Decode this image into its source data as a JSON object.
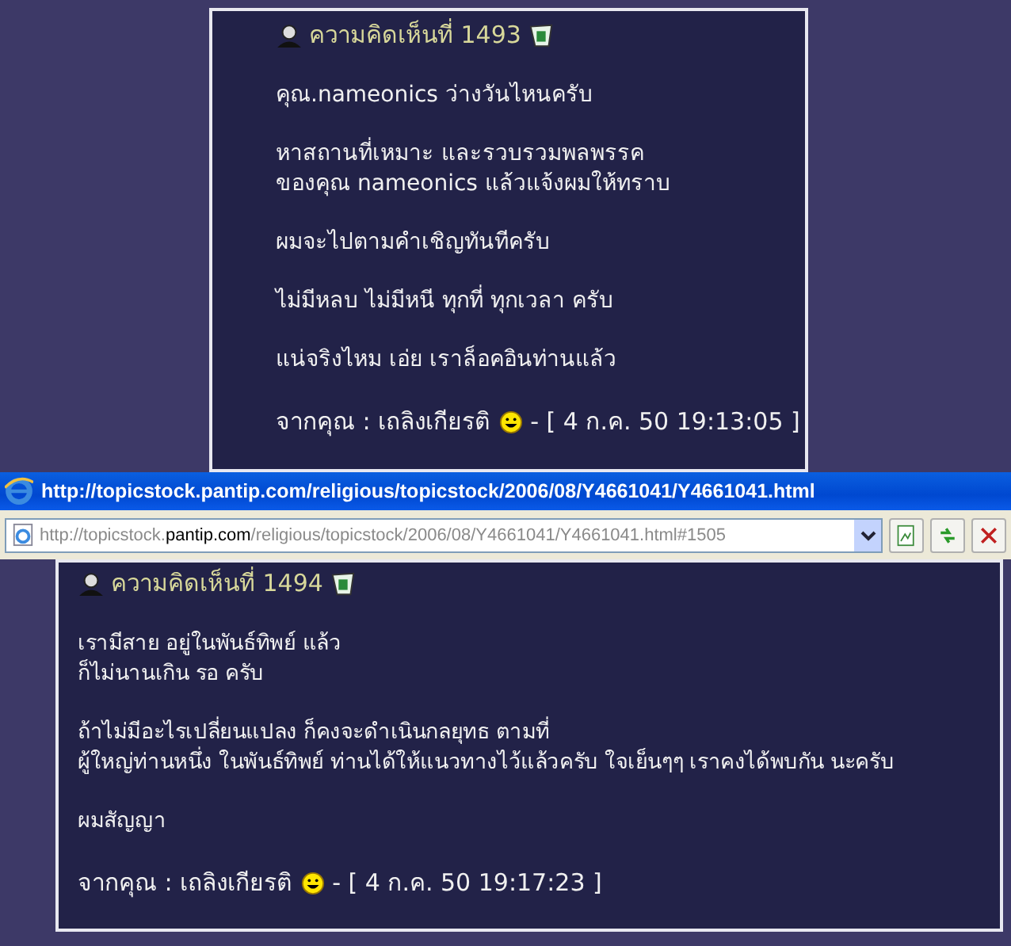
{
  "posts_top": {
    "title": "ความคิดเห็นที่ 1493",
    "paragraphs": [
      [
        "คุณ.nameonics ว่างวันไหนครับ"
      ],
      [
        "หาสถานที่เหมาะ และรวบรวมพลพรรค",
        "ของคุณ nameonics แล้วแจ้งผมให้ทราบ"
      ],
      [
        "ผมจะไปตามคำเชิญทันทีครับ"
      ],
      [
        "ไม่มีหลบ ไม่มีหนี ทุกที่ ทุกเวลา ครับ"
      ],
      [
        "แน่จริงไหม เอ่ย เราล็อคอินท่านแล้ว"
      ]
    ],
    "author": "จากคุณ : เถลิงเกียรติ",
    "date": "- [ 4 ก.ค. 50 19:13:05 ]"
  },
  "browser": {
    "title": "http://topicstock.pantip.com/religious/topicstock/2006/08/Y4661041/Y4661041.html",
    "address_prefix": "http://topicstock.",
    "address_domain": "pantip.com",
    "address_suffix": "/religious/topicstock/2006/08/Y4661041/Y4661041.html#1505"
  },
  "posts_bottom": {
    "title": "ความคิดเห็นที่ 1494",
    "paragraphs": [
      [
        "เรามีสาย อยู่ในพันธ์ทิพย์ แล้ว",
        "ก็ไม่นานเกิน รอ ครับ"
      ],
      [
        "ถ้าไม่มีอะไรเปลี่ยนแปลง ก็คงจะดำเนินกลยุทธ ตามที่",
        "ผู้ใหญ่ท่านหนึ่ง ในพันธ์ทิพย์ ท่านได้ให้แนวทางไว้แล้วครับ ใจเย็นๆๆ เราคงได้พบกัน นะครับ"
      ],
      [
        "ผมสัญญา"
      ]
    ],
    "author": "จากคุณ : เถลิงเกียรติ",
    "date": "- [ 4 ก.ค. 50 19:17:23 ]"
  }
}
